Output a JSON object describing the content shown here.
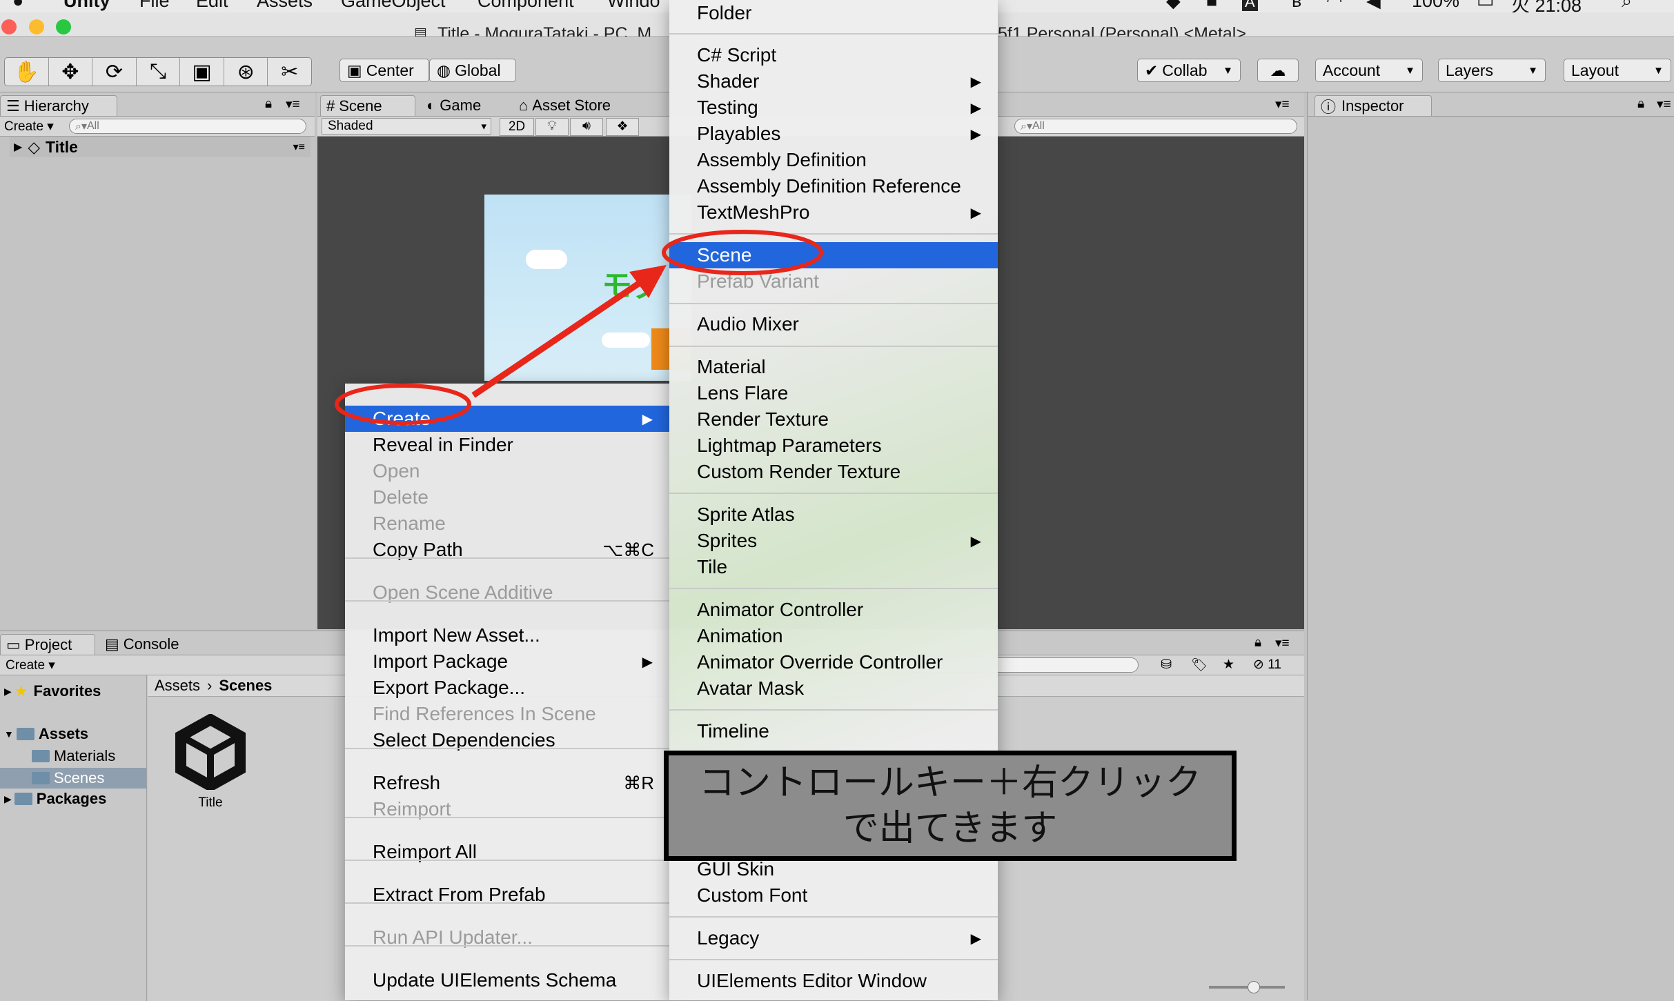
{
  "menubar": {
    "apple": "",
    "items": [
      "Unity",
      "File",
      "Edit",
      "Assets",
      "GameObject",
      "Component",
      "Windo"
    ],
    "status": {
      "battery": "100%",
      "clock": "火 21:08"
    }
  },
  "window": {
    "title_left": "Title - MoguraTataki - PC, M",
    "title_right": "5f1 Personal (Personal) <Metal>"
  },
  "toolbar": {
    "pivot": "Center",
    "space": "Global",
    "collab": "Collab",
    "account": "Account",
    "layers": "Layers",
    "layout": "Layout"
  },
  "hierarchy": {
    "tab": "Hierarchy",
    "create": "Create",
    "search_placeholder": "All",
    "scene_name": "Title"
  },
  "scene_view": {
    "tabs": [
      "Scene",
      "Game",
      "Asset Store"
    ],
    "shading": "Shaded",
    "mode_2d": "2D",
    "search_placeholder": "All"
  },
  "inspector": {
    "tab": "Inspector"
  },
  "project": {
    "tabs": [
      "Project",
      "Console"
    ],
    "create": "Create",
    "hidden_count": "11",
    "favorites": "Favorites",
    "assets": "Assets",
    "materials": "Materials",
    "scenes": "Scenes",
    "packages": "Packages",
    "breadcrumb": [
      "Assets",
      "Scenes"
    ],
    "asset_label": "Title"
  },
  "context_menu": {
    "create": "Create",
    "reveal": "Reveal in Finder",
    "open": "Open",
    "delete": "Delete",
    "rename": "Rename",
    "copy_path": "Copy Path",
    "copy_path_shortcut": "⌥⌘C",
    "open_additive": "Open Scene Additive",
    "import_new": "Import New Asset...",
    "import_package": "Import Package",
    "export_package": "Export Package...",
    "find_refs": "Find References In Scene",
    "select_deps": "Select Dependencies",
    "refresh": "Refresh",
    "refresh_shortcut": "⌘R",
    "reimport": "Reimport",
    "reimport_all": "Reimport All",
    "extract_prefab": "Extract From Prefab",
    "run_api": "Run API Updater...",
    "update_ui": "Update UIElements Schema"
  },
  "create_submenu": {
    "folder": "Folder",
    "csharp": "C# Script",
    "shader": "Shader",
    "testing": "Testing",
    "playables": "Playables",
    "asm_def": "Assembly Definition",
    "asm_ref": "Assembly Definition Reference",
    "tmp": "TextMeshPro",
    "scene": "Scene",
    "prefab_variant": "Prefab Variant",
    "audio_mixer": "Audio Mixer",
    "material": "Material",
    "lens_flare": "Lens Flare",
    "render_texture": "Render Texture",
    "lightmap": "Lightmap Parameters",
    "custom_rt": "Custom Render Texture",
    "sprite_atlas": "Sprite Atlas",
    "sprites": "Sprites",
    "tile": "Tile",
    "anim_controller": "Animator Controller",
    "animation": "Animation",
    "anim_override": "Animator Override Controller",
    "avatar_mask": "Avatar Mask",
    "timeline": "Timeline",
    "gui_skin": "GUI Skin",
    "custom_font": "Custom Font",
    "legacy": "Legacy",
    "ui_window": "UIElements Editor Window"
  },
  "annotation": {
    "text": "コントロールキー＋右クリックで出てきます",
    "color": "#e8261a"
  },
  "colors": {
    "highlight": "#2266dd"
  }
}
